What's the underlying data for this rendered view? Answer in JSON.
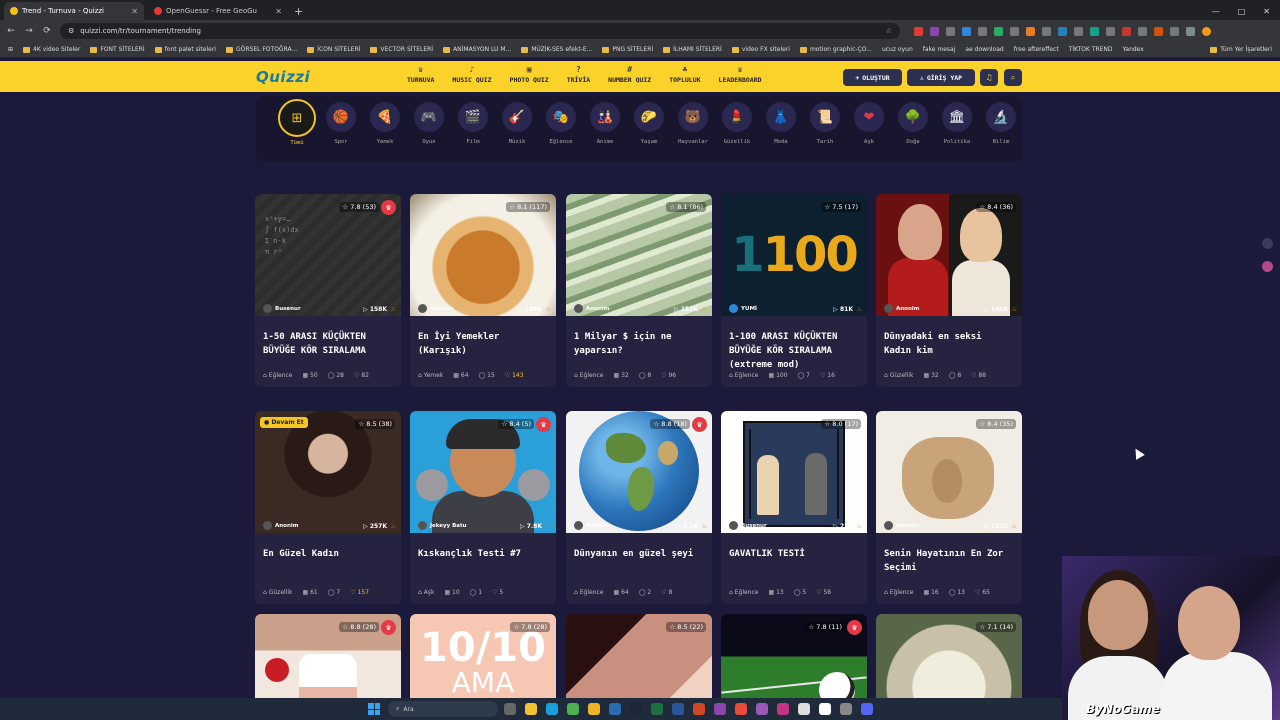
{
  "browser": {
    "tabs": [
      {
        "title": "Trend - Turnuva - Quizzi",
        "active": true
      },
      {
        "title": "OpenGuessr - Free GeoGu",
        "active": false
      }
    ],
    "new_tab": "+",
    "url": "quizzi.com/tr/tournament/trending",
    "window_controls": [
      "—",
      "□",
      "✕"
    ],
    "bookmarks": [
      "4K video Siteler",
      "FONT SİTELERİ",
      "font palet siteleri",
      "GÖRSEL FOTOĞRA...",
      "İCON SİTELERİ",
      "VECTOR SİTELERİ",
      "ANİMASYON LU M...",
      "MÜZİK-SES efekt-E...",
      "PNG SİTELERİ",
      "İLHAMI SİTELERİ",
      "video FX siteleri",
      "motion graphic-ÇO...",
      "ucuz oyun",
      "fake mesaj",
      "ae download",
      "free aftereffect",
      "TİKTOK TREND",
      "Yandex",
      "Tüm Yer İşaretleri"
    ]
  },
  "header": {
    "logo": "Quizzi",
    "nav": [
      {
        "icon": "♛",
        "label": "TURNUVA"
      },
      {
        "icon": "♪",
        "label": "MUSIC QUIZ"
      },
      {
        "icon": "▣",
        "label": "PHOTO QUIZ"
      },
      {
        "icon": "?",
        "label": "TRİVİA"
      },
      {
        "icon": "#",
        "label": "NUMBER QUIZ"
      },
      {
        "icon": "♣",
        "label": "TOPLULUK"
      },
      {
        "icon": "♛",
        "label": "LEADERBOARD"
      }
    ],
    "create_label": "OLUŞTUR",
    "login_label": "GİRİŞ YAP"
  },
  "categories": [
    {
      "icon": "⊞",
      "label": "Tümü",
      "active": true
    },
    {
      "icon": "🏀",
      "label": "Spor"
    },
    {
      "icon": "🍕",
      "label": "Yemek"
    },
    {
      "icon": "🎮",
      "label": "Oyun"
    },
    {
      "icon": "🎬",
      "label": "Film"
    },
    {
      "icon": "🎸",
      "label": "Müzik"
    },
    {
      "icon": "🎭",
      "label": "Eğlence"
    },
    {
      "icon": "🎎",
      "label": "Anime"
    },
    {
      "icon": "🌮",
      "label": "Yaşam"
    },
    {
      "icon": "🐻",
      "label": "Hayvanlar"
    },
    {
      "icon": "💄",
      "label": "Güzellik"
    },
    {
      "icon": "👗",
      "label": "Moda"
    },
    {
      "icon": "📜",
      "label": "Tarih"
    },
    {
      "icon": "❤",
      "label": "Aşk"
    },
    {
      "icon": "🌳",
      "label": "Doğa"
    },
    {
      "icon": "🏛",
      "label": "Politika"
    },
    {
      "icon": "🔬",
      "label": "Bilim"
    }
  ],
  "cards": [
    {
      "thumb": "t-board",
      "rating": "☆ 7.8 (53)",
      "crown": true,
      "author": "Busenur",
      "plays": "▷ 158K",
      "title": "1-50 ARASI KÜÇÜKTEN BÜYÜĞE KÖR SIRALAMA",
      "category": "Eğlence",
      "items": "50",
      "comments": "28",
      "likes": "82",
      "likes_gold": false,
      "board": "x²+y=…\n∫ f(x)dx\nΣ n·k\nπ r²"
    },
    {
      "thumb": "t-food",
      "rating": "☆ 8.1 (117)",
      "crown": false,
      "author": "Anonim",
      "plays": "▷ 188K",
      "title": "En İyi Yemekler (Karışık)",
      "category": "Yemek",
      "items": "64",
      "comments": "15",
      "likes": "143",
      "likes_gold": true
    },
    {
      "thumb": "t-money",
      "rating": "☆ 8.1 (86)",
      "crown": false,
      "author": "Anonim",
      "plays": "▷ 153K",
      "title": "1 Milyar $ için ne yaparsın?",
      "category": "Eğlence",
      "items": "32",
      "comments": "8",
      "likes": "96",
      "likes_gold": false
    },
    {
      "thumb": "t-1100",
      "rating": "☆ 7.5 (17)",
      "crown": false,
      "author": "YUMİ",
      "plays": "▷ 81K",
      "title": "1-100 ARASI KÜÇÜKTEN BÜYÜĞE KÖR SIRALAMA (extreme mod)",
      "category": "Eğlence",
      "items": "100",
      "comments": "7",
      "likes": "16",
      "likes_gold": false,
      "big_a": "1",
      "big_b": "100"
    },
    {
      "thumb": "t-women",
      "rating": "☆ 8.4 (36)",
      "crown": false,
      "author": "Anonim",
      "plays": "▷ 140K",
      "title": "Dünyadaki en seksi Kadın kim",
      "category": "Güzellik",
      "items": "32",
      "comments": "8",
      "likes": "88",
      "likes_gold": false
    },
    {
      "thumb": "t-portrait",
      "rating": "☆ 8.5 (38)",
      "crown": false,
      "live": "● Devam Et",
      "author": "Anonim",
      "plays": "▷ 257K",
      "title": "En Güzel Kadın",
      "category": "Güzellik",
      "items": "61",
      "comments": "7",
      "likes": "157",
      "likes_gold": true
    },
    {
      "thumb": "t-cartoon",
      "rating": "☆ 8.4 (5)",
      "crown": true,
      "author": "Jekeyy Batu",
      "plays": "▷ 7.8K",
      "title": "Kıskançlık Testi #7",
      "category": "Aşk",
      "items": "10",
      "comments": "1",
      "likes": "5",
      "likes_gold": false
    },
    {
      "thumb": "t-globe",
      "rating": "☆ 8.8 (18)",
      "crown": true,
      "author": "Anonim",
      "plays": "▷ 7.1K",
      "title": "Dünyanın en güzel şeyi",
      "category": "Eğlence",
      "items": "64",
      "comments": "2",
      "likes": "8",
      "likes_gold": false
    },
    {
      "thumb": "t-comic",
      "rating": "☆ 8.0 (17)",
      "crown": false,
      "author": "Busenur",
      "plays": "▷ 23K",
      "title": "GAVATLIK TESTİ",
      "category": "Eğlence",
      "items": "13",
      "comments": "5",
      "likes": "58",
      "likes_gold": false
    },
    {
      "thumb": "t-hand",
      "rating": "☆ 8.4 (35)",
      "crown": false,
      "author": "Anonim",
      "plays": "▷ 192K",
      "title": "Senin Hayatının En Zor Seçimi",
      "category": "Eğlence",
      "items": "16",
      "comments": "13",
      "likes": "65",
      "likes_gold": false
    },
    {
      "thumb": "t-dessert",
      "rating": "☆ 8.8 (28)",
      "crown": true
    },
    {
      "thumb": "t-1010",
      "rating": "☆ 7.8 (28)",
      "crown": false,
      "big_a": "10/10",
      "big_b": "AMA"
    },
    {
      "thumb": "t-face2",
      "rating": "☆ 8.5 (22)",
      "crown": false
    },
    {
      "thumb": "t-soccer",
      "rating": "☆ 7.8 (11)",
      "crown": true
    },
    {
      "thumb": "t-wrap",
      "rating": "☆ 7.1 (14)",
      "crown": false
    }
  ],
  "webcam": {
    "watermark": "ByNoGame"
  },
  "taskbar": {
    "search_placeholder": "Ara"
  },
  "colors": {
    "header_yellow": "#fbd22a",
    "page_bg": "#1c1a3a",
    "card_bg": "#25233f",
    "crown_red": "#e53945",
    "accent_gold": "#f3c623"
  }
}
